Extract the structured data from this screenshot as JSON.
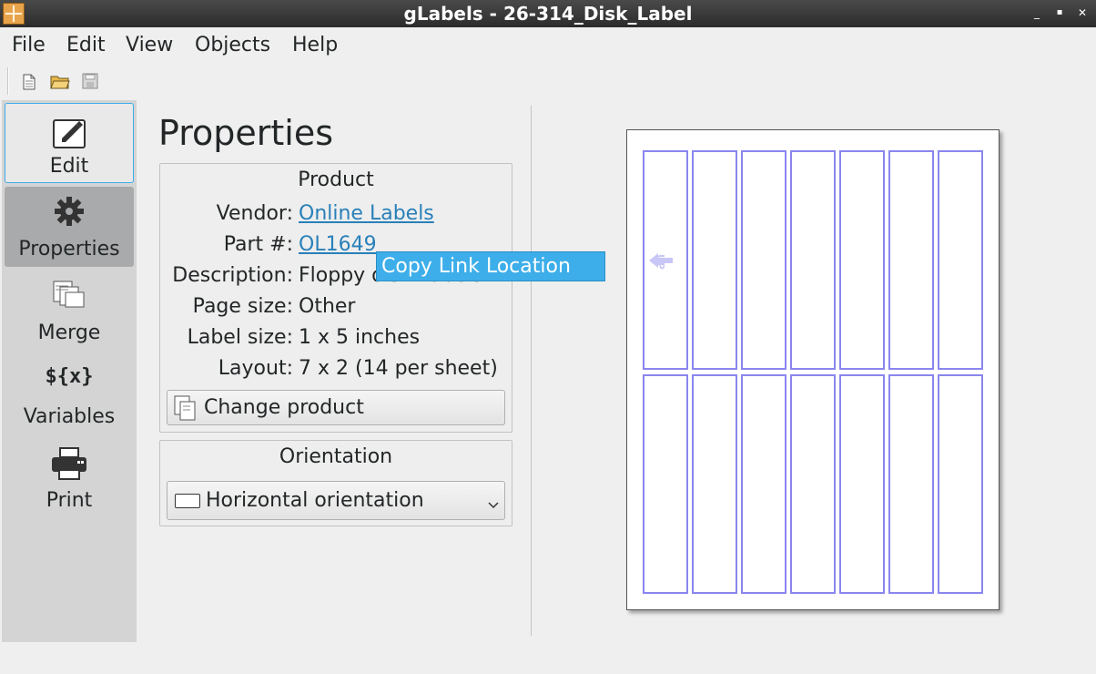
{
  "window": {
    "title": "gLabels - 26-314_Disk_Label",
    "controls": [
      "_",
      "▪",
      "✕"
    ]
  },
  "menubar": {
    "items": [
      "File",
      "Edit",
      "View",
      "Objects",
      "Help"
    ]
  },
  "toolbar": {
    "buttons": [
      "new-document-icon",
      "open-folder-icon",
      "save-icon"
    ]
  },
  "sidebar": {
    "items": [
      {
        "label": "Edit",
        "icon": "edit-icon"
      },
      {
        "label": "Properties",
        "icon": "gear-icon"
      },
      {
        "label": "Merge",
        "icon": "merge-icon"
      },
      {
        "label": "Variables",
        "icon": "variables-icon",
        "glyph": "${x}"
      },
      {
        "label": "Print",
        "icon": "printer-icon"
      }
    ],
    "selected": "Properties"
  },
  "properties": {
    "title": "Properties",
    "product": {
      "group_title": "Product",
      "vendor_label": "Vendor:",
      "vendor_value": "Online Labels",
      "part_label": "Part #:",
      "part_value": "OL1649",
      "description_label": "Description:",
      "description_value": "Floppy disk Labels",
      "page_size_label": "Page size:",
      "page_size_value": "Other",
      "label_size_label": "Label size:",
      "label_size_value": "1 x 5 inches",
      "layout_label": "Layout:",
      "layout_value": "7 x 2 (14 per sheet)",
      "change_button": "Change product"
    },
    "orientation": {
      "group_title": "Orientation",
      "selected": "Horizontal orientation"
    }
  },
  "context_popup": {
    "label": "Copy Link Location"
  },
  "preview": {
    "columns": 7,
    "rows": 2,
    "up_label": "UP"
  },
  "colors": {
    "accent": "#3daee9",
    "link": "#2980b9",
    "label_outline": "#8a86ee"
  }
}
